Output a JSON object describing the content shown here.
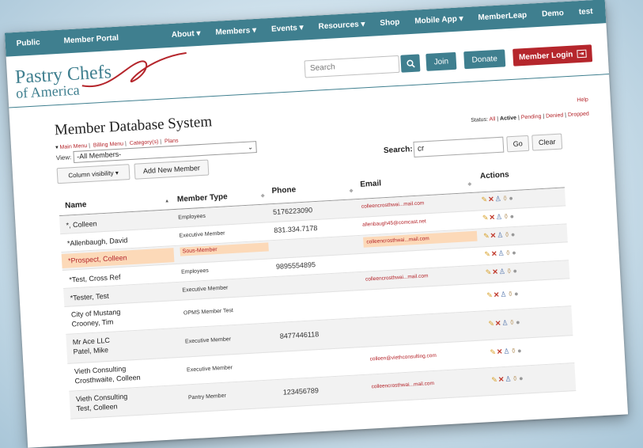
{
  "topnav": {
    "left": [
      "Public",
      "Member Portal"
    ],
    "right": [
      "About ▾",
      "Members ▾",
      "Events ▾",
      "Resources ▾",
      "Shop",
      "Mobile App ▾",
      "MemberLeap",
      "Demo",
      "test"
    ]
  },
  "logo": {
    "line1": "Pastry Chefs",
    "line2": "of America"
  },
  "header": {
    "search_placeholder": "Search",
    "join": "Join",
    "donate": "Donate",
    "login": "Member Login"
  },
  "page": {
    "title": "Member Database System",
    "help": "Help",
    "menu_links": [
      "Main Menu",
      "Billing Menu",
      "Category(s)",
      "Plans"
    ],
    "view_label": "View:",
    "view_value": "-All Members-",
    "status_label": "Status:",
    "status_options": [
      "All",
      "Active",
      "Pending",
      "Denied",
      "Dropped"
    ],
    "column_visibility": "Column visibility ▾",
    "add_member": "Add New Member",
    "search_label": "Search:",
    "search_value": "cr",
    "go": "Go",
    "clear": "Clear"
  },
  "table": {
    "headers": {
      "name": "Name",
      "type": "Member Type",
      "phone": "Phone",
      "email": "Email",
      "actions": "Actions"
    },
    "rows": [
      {
        "name1": "*, Colleen",
        "name2": "",
        "type": "Employees",
        "phone": "5176223090",
        "email": "colleencrosthwai...mail.com"
      },
      {
        "name1": "*Allenbaugh, David",
        "name2": "",
        "type": "Executive Member",
        "phone": "831.334.7178",
        "email": "allenbaugh45@comcast.net"
      },
      {
        "name1": "*Prospect, Colleen",
        "name2": "",
        "type": "Sous-Member",
        "phone": "",
        "email": "colleencrosthwai...mail.com"
      },
      {
        "name1": "*Test, Cross Ref",
        "name2": "",
        "type": "Employees",
        "phone": "9895554895",
        "email": ""
      },
      {
        "name1": "*Tester, Test",
        "name2": "",
        "type": "Executive Member",
        "phone": "",
        "email": "colleencrosthwai...mail.com"
      },
      {
        "name1": "City of Mustang",
        "name2": "Crooney, Tim",
        "type": "OPMS Member Test",
        "phone": "",
        "email": ""
      },
      {
        "name1": "Mr Ace LLC",
        "name2": "Patel, Mike",
        "type": "Executive Member",
        "phone": "8477446118",
        "email": ""
      },
      {
        "name1": "Vieth Consulting",
        "name2": "Crosthwaite, Colleen",
        "type": "Executive Member",
        "phone": "",
        "email": "colleen@viethconsulting.com"
      },
      {
        "name1": "Vieth Consulting",
        "name2": "Test, Colleen",
        "type": "Pantry Member",
        "phone": "123456789",
        "email": "colleencrosthwai...mail.com"
      }
    ]
  },
  "icons": {
    "search": "search-icon",
    "login": "login-icon",
    "edit": "pencil-icon",
    "delete": "x-icon",
    "user": "user-icon",
    "note": "drop-icon",
    "settings": "gear-icon"
  },
  "colors": {
    "nav": "#3f7f8f",
    "accent_red": "#b5262c",
    "highlight": "#fcd9b8"
  }
}
